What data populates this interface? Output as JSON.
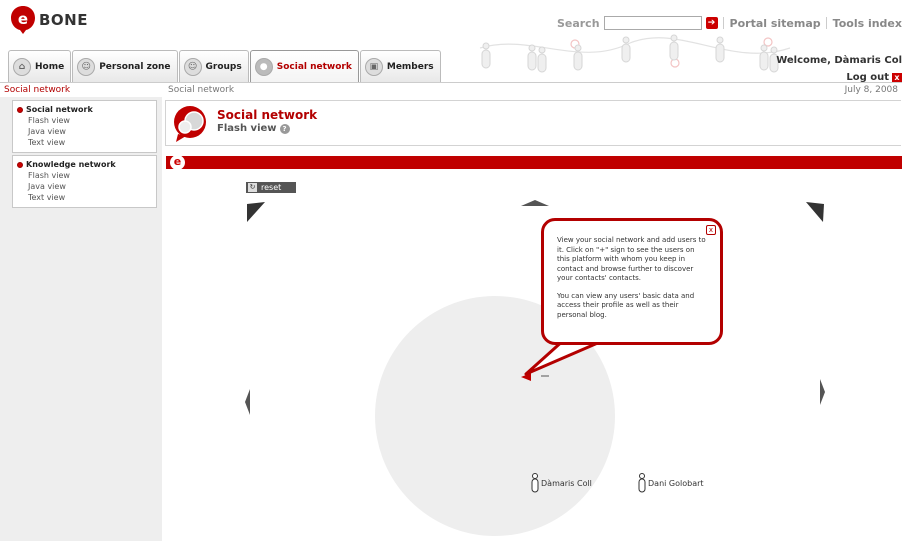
{
  "brand": {
    "name": "BONE",
    "color": "#c00000"
  },
  "topbar": {
    "search_label": "Search",
    "search_value": "",
    "go_icon": "arrow-right-icon",
    "links": [
      "Portal sitemap",
      "Tools index"
    ]
  },
  "user": {
    "welcome": "Welcome, Dàmaris Col",
    "logout": "Log out",
    "logout_icon": "close-icon"
  },
  "tabs": [
    {
      "label": "Home",
      "icon": "home-icon",
      "active": false
    },
    {
      "label": "Personal zone",
      "icon": "person-icon",
      "active": false
    },
    {
      "label": "Groups",
      "icon": "groups-icon",
      "active": false
    },
    {
      "label": "Social network",
      "icon": "network-icon",
      "active": true
    },
    {
      "label": "Members",
      "icon": "members-icon",
      "active": false
    }
  ],
  "breadcrumb": {
    "section": "Social network",
    "current": "Social network",
    "date": "July 8, 2008"
  },
  "sidebar": {
    "groups": [
      {
        "title": "Social network",
        "items": [
          "Flash view",
          "Java view",
          "Text view"
        ]
      },
      {
        "title": "Knowledge network",
        "items": [
          "Flash view",
          "Java view",
          "Text view"
        ]
      }
    ]
  },
  "page": {
    "title": "Social network",
    "subtitle": "Flash view",
    "help_icon": "help-icon",
    "bar_letter": "e"
  },
  "viewer": {
    "reset_label": "reset",
    "reset_icon": "reset-icon",
    "users": [
      "Dàmaris Coll",
      "Dani Golobart"
    ]
  },
  "tooltip": {
    "close_label": "x",
    "paragraphs": [
      "View your social network and add users to it. Click on \"+\" sign to see the users on this platform with whom you keep in contact and browse further to discover your contacts' contacts.",
      "You can view any users' basic data and access their profile as well as their personal blog."
    ]
  }
}
